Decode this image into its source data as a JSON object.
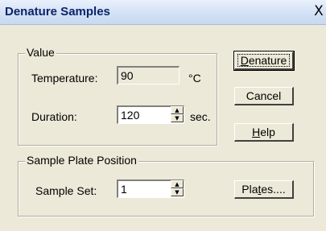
{
  "dialog": {
    "title": "Denature Samples",
    "close_glyph": "X"
  },
  "value_group": {
    "title": "Value",
    "temperature_label": "Temperature:",
    "temperature_value": "90",
    "temperature_unit": "°C",
    "duration_label": "Duration:",
    "duration_value": "120",
    "duration_unit": "sec."
  },
  "plate_group": {
    "title": "Sample Plate Position",
    "sample_set_label": "Sample Set:",
    "sample_set_value": "1"
  },
  "buttons": {
    "denature": {
      "pre": "",
      "mnemonic": "D",
      "post": "enature"
    },
    "cancel": "Cancel",
    "help": {
      "pre": "",
      "mnemonic": "H",
      "post": "elp"
    },
    "plates": {
      "pre": "Pla",
      "mnemonic": "t",
      "post": "es...."
    }
  }
}
